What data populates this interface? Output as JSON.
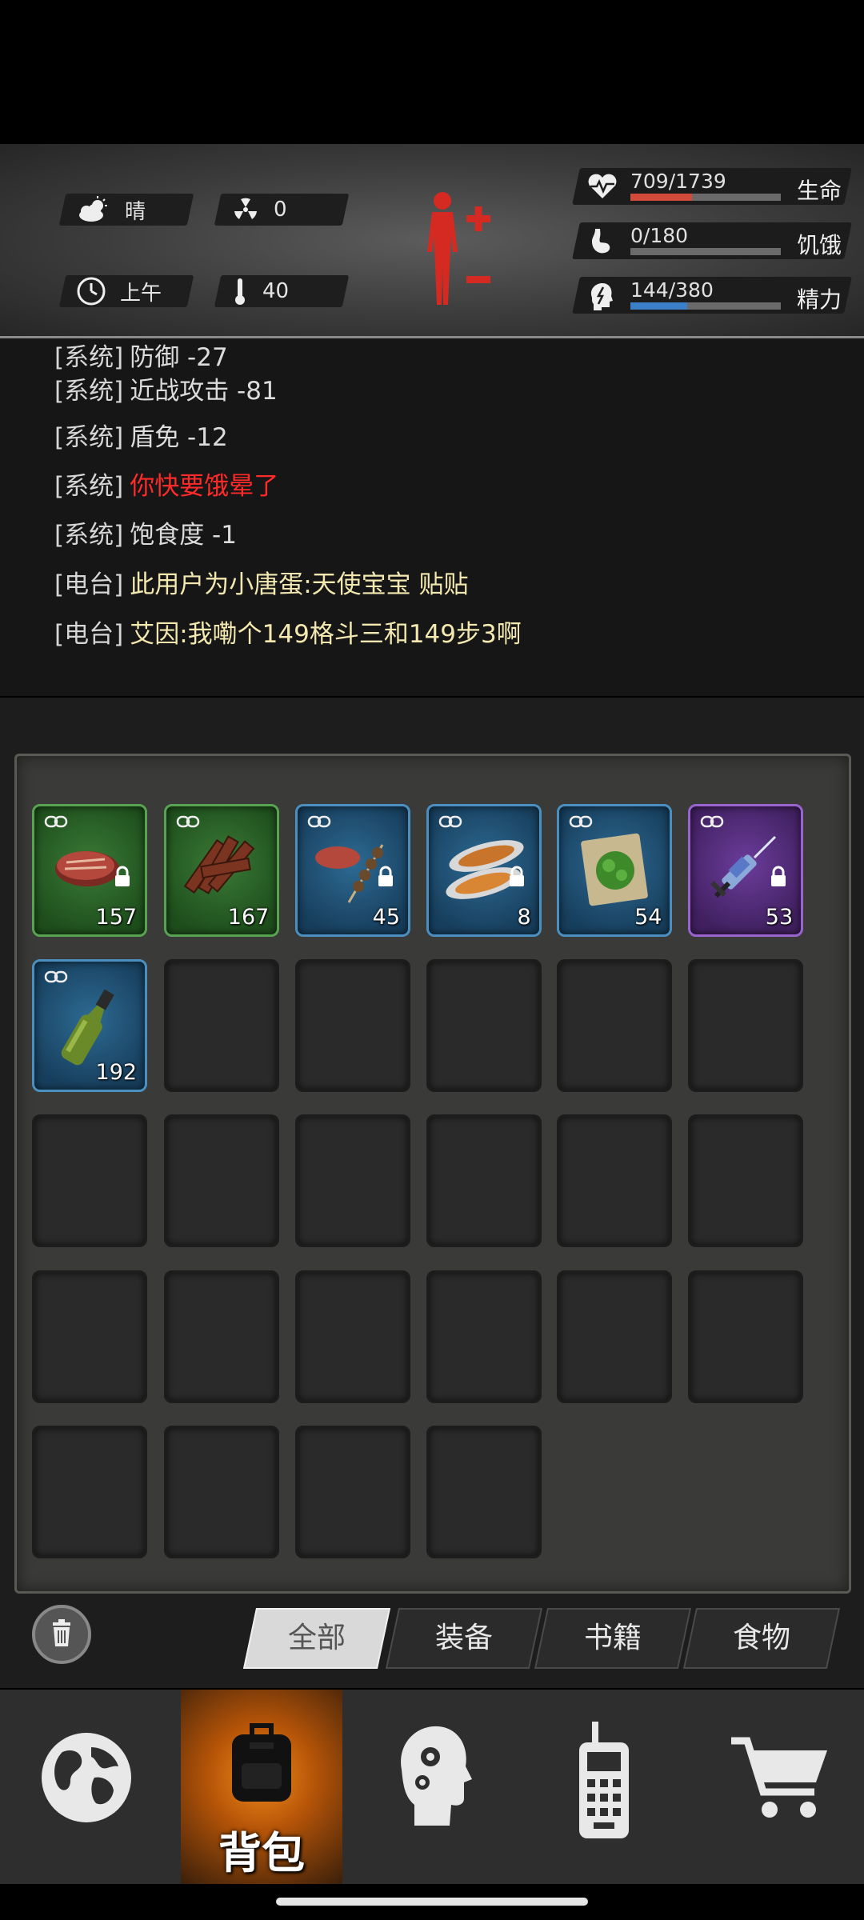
{
  "status": {
    "weather": "晴",
    "radiation": "0",
    "time_of_day": "上午",
    "temperature": "40",
    "health": {
      "value": "709/1739",
      "label": "生命",
      "fraction": 0.41,
      "color": "#d24a3a"
    },
    "hunger": {
      "value": "0/180",
      "label": "饥饿",
      "fraction": 0.0,
      "color": "#a0a0a0"
    },
    "energy": {
      "value": "144/380",
      "label": "精力",
      "fraction": 0.38,
      "color": "#3a7fc8"
    }
  },
  "log": {
    "lines": [
      {
        "tag": "[系统]",
        "text": "防御 -27",
        "kind": "system"
      },
      {
        "tag": "[系统]",
        "text": "近战攻击 -81",
        "kind": "system"
      },
      {
        "tag": "[系统]",
        "text": "盾免 -12",
        "kind": "system"
      },
      {
        "tag": "[系统]",
        "text": "你快要饿晕了",
        "kind": "alert"
      },
      {
        "tag": "[系统]",
        "text": "饱食度 -1",
        "kind": "system"
      },
      {
        "tag": "[电台]",
        "text": "此用户为小唐蛋:天使宝宝 贴贴",
        "kind": "radio"
      },
      {
        "tag": "[电台]",
        "text": "艾因:我嘞个149格斗三和149步3啊",
        "kind": "radio"
      }
    ]
  },
  "inventory": {
    "items": [
      {
        "icon": "steak-icon",
        "qty": "157",
        "rarity": "green",
        "locked": true
      },
      {
        "icon": "jerky-icon",
        "qty": "167",
        "rarity": "green",
        "locked": false
      },
      {
        "icon": "skewer-icon",
        "qty": "45",
        "rarity": "blue",
        "locked": true
      },
      {
        "icon": "grilled-fish-icon",
        "qty": "8",
        "rarity": "blue",
        "locked": true
      },
      {
        "icon": "herb-poultice-icon",
        "qty": "54",
        "rarity": "blue",
        "locked": false
      },
      {
        "icon": "syringe-icon",
        "qty": "53",
        "rarity": "purple",
        "locked": true
      },
      {
        "icon": "bottle-icon",
        "qty": "192",
        "rarity": "blue",
        "locked": false
      }
    ],
    "total_slots": 28
  },
  "filters": {
    "tabs": [
      "全部",
      "装备",
      "书籍",
      "食物"
    ],
    "active": 0
  },
  "nav": {
    "items": [
      {
        "icon": "globe-icon",
        "label": ""
      },
      {
        "icon": "backpack-icon",
        "label": "背包"
      },
      {
        "icon": "skills-head-icon",
        "label": ""
      },
      {
        "icon": "radio-icon",
        "label": ""
      },
      {
        "icon": "shop-cart-icon",
        "label": ""
      }
    ],
    "active": 1
  }
}
